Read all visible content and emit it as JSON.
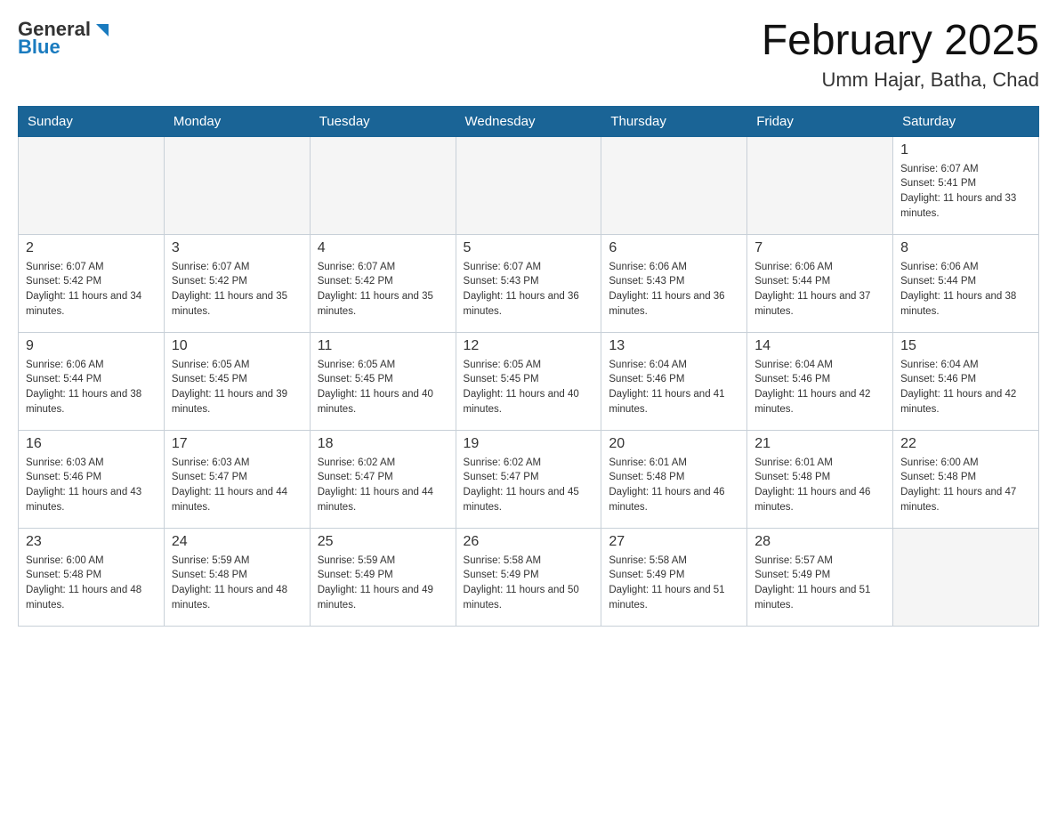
{
  "header": {
    "logo_general": "General",
    "logo_blue": "Blue",
    "title": "February 2025",
    "subtitle": "Umm Hajar, Batha, Chad"
  },
  "weekdays": [
    "Sunday",
    "Monday",
    "Tuesday",
    "Wednesday",
    "Thursday",
    "Friday",
    "Saturday"
  ],
  "weeks": [
    [
      {
        "day": "",
        "sunrise": "",
        "sunset": "",
        "daylight": ""
      },
      {
        "day": "",
        "sunrise": "",
        "sunset": "",
        "daylight": ""
      },
      {
        "day": "",
        "sunrise": "",
        "sunset": "",
        "daylight": ""
      },
      {
        "day": "",
        "sunrise": "",
        "sunset": "",
        "daylight": ""
      },
      {
        "day": "",
        "sunrise": "",
        "sunset": "",
        "daylight": ""
      },
      {
        "day": "",
        "sunrise": "",
        "sunset": "",
        "daylight": ""
      },
      {
        "day": "1",
        "sunrise": "Sunrise: 6:07 AM",
        "sunset": "Sunset: 5:41 PM",
        "daylight": "Daylight: 11 hours and 33 minutes."
      }
    ],
    [
      {
        "day": "2",
        "sunrise": "Sunrise: 6:07 AM",
        "sunset": "Sunset: 5:42 PM",
        "daylight": "Daylight: 11 hours and 34 minutes."
      },
      {
        "day": "3",
        "sunrise": "Sunrise: 6:07 AM",
        "sunset": "Sunset: 5:42 PM",
        "daylight": "Daylight: 11 hours and 35 minutes."
      },
      {
        "day": "4",
        "sunrise": "Sunrise: 6:07 AM",
        "sunset": "Sunset: 5:42 PM",
        "daylight": "Daylight: 11 hours and 35 minutes."
      },
      {
        "day": "5",
        "sunrise": "Sunrise: 6:07 AM",
        "sunset": "Sunset: 5:43 PM",
        "daylight": "Daylight: 11 hours and 36 minutes."
      },
      {
        "day": "6",
        "sunrise": "Sunrise: 6:06 AM",
        "sunset": "Sunset: 5:43 PM",
        "daylight": "Daylight: 11 hours and 36 minutes."
      },
      {
        "day": "7",
        "sunrise": "Sunrise: 6:06 AM",
        "sunset": "Sunset: 5:44 PM",
        "daylight": "Daylight: 11 hours and 37 minutes."
      },
      {
        "day": "8",
        "sunrise": "Sunrise: 6:06 AM",
        "sunset": "Sunset: 5:44 PM",
        "daylight": "Daylight: 11 hours and 38 minutes."
      }
    ],
    [
      {
        "day": "9",
        "sunrise": "Sunrise: 6:06 AM",
        "sunset": "Sunset: 5:44 PM",
        "daylight": "Daylight: 11 hours and 38 minutes."
      },
      {
        "day": "10",
        "sunrise": "Sunrise: 6:05 AM",
        "sunset": "Sunset: 5:45 PM",
        "daylight": "Daylight: 11 hours and 39 minutes."
      },
      {
        "day": "11",
        "sunrise": "Sunrise: 6:05 AM",
        "sunset": "Sunset: 5:45 PM",
        "daylight": "Daylight: 11 hours and 40 minutes."
      },
      {
        "day": "12",
        "sunrise": "Sunrise: 6:05 AM",
        "sunset": "Sunset: 5:45 PM",
        "daylight": "Daylight: 11 hours and 40 minutes."
      },
      {
        "day": "13",
        "sunrise": "Sunrise: 6:04 AM",
        "sunset": "Sunset: 5:46 PM",
        "daylight": "Daylight: 11 hours and 41 minutes."
      },
      {
        "day": "14",
        "sunrise": "Sunrise: 6:04 AM",
        "sunset": "Sunset: 5:46 PM",
        "daylight": "Daylight: 11 hours and 42 minutes."
      },
      {
        "day": "15",
        "sunrise": "Sunrise: 6:04 AM",
        "sunset": "Sunset: 5:46 PM",
        "daylight": "Daylight: 11 hours and 42 minutes."
      }
    ],
    [
      {
        "day": "16",
        "sunrise": "Sunrise: 6:03 AM",
        "sunset": "Sunset: 5:46 PM",
        "daylight": "Daylight: 11 hours and 43 minutes."
      },
      {
        "day": "17",
        "sunrise": "Sunrise: 6:03 AM",
        "sunset": "Sunset: 5:47 PM",
        "daylight": "Daylight: 11 hours and 44 minutes."
      },
      {
        "day": "18",
        "sunrise": "Sunrise: 6:02 AM",
        "sunset": "Sunset: 5:47 PM",
        "daylight": "Daylight: 11 hours and 44 minutes."
      },
      {
        "day": "19",
        "sunrise": "Sunrise: 6:02 AM",
        "sunset": "Sunset: 5:47 PM",
        "daylight": "Daylight: 11 hours and 45 minutes."
      },
      {
        "day": "20",
        "sunrise": "Sunrise: 6:01 AM",
        "sunset": "Sunset: 5:48 PM",
        "daylight": "Daylight: 11 hours and 46 minutes."
      },
      {
        "day": "21",
        "sunrise": "Sunrise: 6:01 AM",
        "sunset": "Sunset: 5:48 PM",
        "daylight": "Daylight: 11 hours and 46 minutes."
      },
      {
        "day": "22",
        "sunrise": "Sunrise: 6:00 AM",
        "sunset": "Sunset: 5:48 PM",
        "daylight": "Daylight: 11 hours and 47 minutes."
      }
    ],
    [
      {
        "day": "23",
        "sunrise": "Sunrise: 6:00 AM",
        "sunset": "Sunset: 5:48 PM",
        "daylight": "Daylight: 11 hours and 48 minutes."
      },
      {
        "day": "24",
        "sunrise": "Sunrise: 5:59 AM",
        "sunset": "Sunset: 5:48 PM",
        "daylight": "Daylight: 11 hours and 48 minutes."
      },
      {
        "day": "25",
        "sunrise": "Sunrise: 5:59 AM",
        "sunset": "Sunset: 5:49 PM",
        "daylight": "Daylight: 11 hours and 49 minutes."
      },
      {
        "day": "26",
        "sunrise": "Sunrise: 5:58 AM",
        "sunset": "Sunset: 5:49 PM",
        "daylight": "Daylight: 11 hours and 50 minutes."
      },
      {
        "day": "27",
        "sunrise": "Sunrise: 5:58 AM",
        "sunset": "Sunset: 5:49 PM",
        "daylight": "Daylight: 11 hours and 51 minutes."
      },
      {
        "day": "28",
        "sunrise": "Sunrise: 5:57 AM",
        "sunset": "Sunset: 5:49 PM",
        "daylight": "Daylight: 11 hours and 51 minutes."
      },
      {
        "day": "",
        "sunrise": "",
        "sunset": "",
        "daylight": ""
      }
    ]
  ]
}
